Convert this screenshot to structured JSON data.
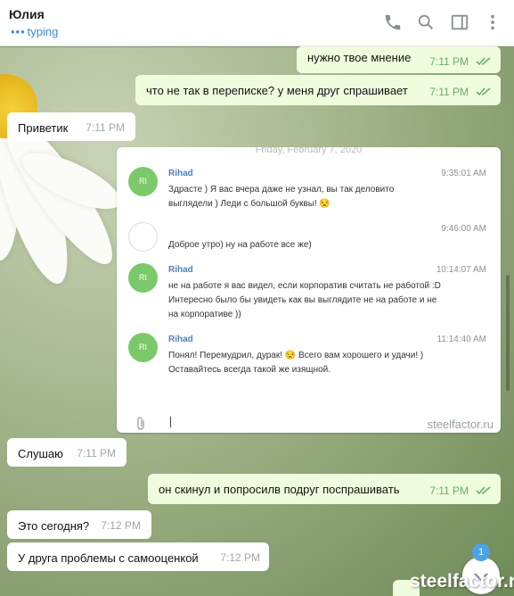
{
  "header": {
    "name": "Юлия",
    "status": "typing",
    "icons": [
      "phone-icon",
      "search-icon",
      "sidebar-icon",
      "more-icon"
    ]
  },
  "messages": [
    {
      "dir": "out",
      "text": "нужно твое мнение",
      "time": "7:11 PM"
    },
    {
      "dir": "out",
      "text": "что не так в переписке? у меня друг спрашивает",
      "time": "7:11 PM"
    },
    {
      "dir": "in",
      "text": "Приветик",
      "time": "7:11 PM"
    },
    {
      "dir": "in",
      "text": "Слушаю",
      "time": "7:11 PM"
    },
    {
      "dir": "out",
      "text": "он скинул и попросилв  подруг поспрашивать",
      "time": "7:11 PM"
    },
    {
      "dir": "in",
      "text": "Это сегодня?",
      "time": "7:12 PM"
    },
    {
      "dir": "in",
      "text": "У друга проблемы с самооценкой",
      "time": "7:12 PM"
    }
  ],
  "screenshot": {
    "date": "Friday, February 7, 2020",
    "rows": [
      {
        "avatar": "RI",
        "name": "Rihad",
        "time": "9:35:01 AM",
        "text": "Здрасте ) Я вас вчера даже не узнал, вы так деловито выглядели ) Леди с большой буквы! 😒"
      },
      {
        "avatar": "",
        "name": "",
        "time": "9:46:00 AM",
        "text": "Доброе утро) ну на работе все же)"
      },
      {
        "avatar": "RI",
        "name": "Rihad",
        "time": "10:14:07 AM",
        "text": "не на работе я вас видел, если корпоратив считать не работой :D Интересно было бы увидеть как вы выглядите не на работе и не на корпоративе ))"
      },
      {
        "avatar": "RI",
        "name": "Rihad",
        "time": "11:14:40 AM",
        "text": "Понял! Перемудрил, дурак! 😒   Всего вам хорошего и удачи! ) Оставайтесь всегда такой же изящной."
      }
    ],
    "watermark": "steelfactor.ru"
  },
  "unread_badge": "1",
  "watermark": "steelfactor.ru",
  "colors": {
    "out_bubble": "#effdde",
    "in_bubble": "#ffffff",
    "accent": "#3a8fd1",
    "check": "#6bad6b"
  }
}
